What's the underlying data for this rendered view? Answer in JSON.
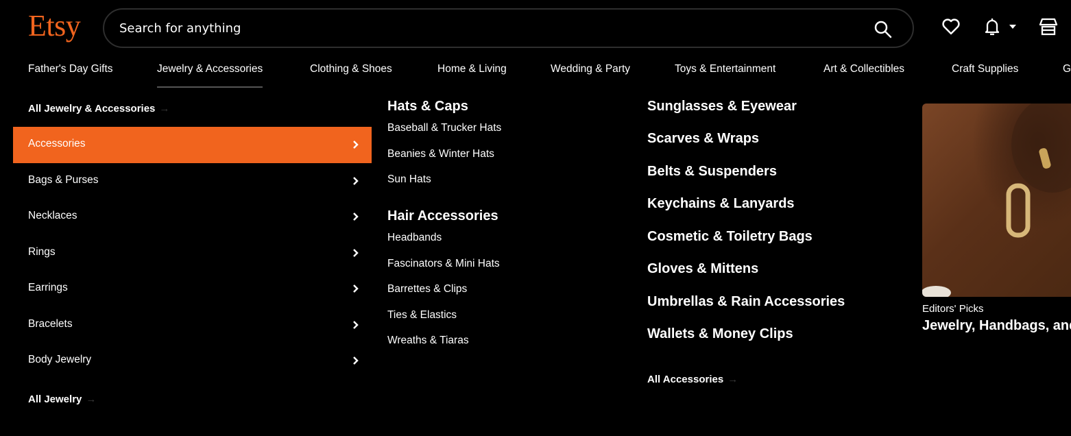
{
  "header": {
    "logo": "Etsy",
    "search_placeholder": "Search for anything",
    "search_value": "",
    "icons": [
      "search-icon",
      "heart-icon",
      "bell-icon",
      "caret-down-icon",
      "shop-icon"
    ]
  },
  "nav": {
    "items": [
      {
        "label": "Father's Day Gifts"
      },
      {
        "label": "Jewelry & Accessories",
        "active": true
      },
      {
        "label": "Clothing & Shoes"
      },
      {
        "label": "Home & Living"
      },
      {
        "label": "Wedding & Party"
      },
      {
        "label": "Toys & Entertainment"
      },
      {
        "label": "Art & Collectibles"
      },
      {
        "label": "Craft Supplies"
      },
      {
        "label": "G"
      }
    ]
  },
  "menu": {
    "all_top": "All Jewelry & Accessories",
    "categories": [
      {
        "label": "Accessories",
        "active": true
      },
      {
        "label": "Bags & Purses"
      },
      {
        "label": "Necklaces"
      },
      {
        "label": "Rings"
      },
      {
        "label": "Earrings"
      },
      {
        "label": "Bracelets"
      },
      {
        "label": "Body Jewelry"
      }
    ],
    "all_bottom": "All Jewelry",
    "accent_color": "#f1641e"
  },
  "sub_columns": {
    "hats": {
      "heading": "Hats & Caps",
      "items": [
        "Baseball & Trucker Hats",
        "Beanies & Winter Hats",
        "Sun Hats"
      ]
    },
    "hair": {
      "heading": "Hair Accessories",
      "items": [
        "Headbands",
        "Fascinators & Mini Hats",
        "Barrettes & Clips",
        "Ties & Elastics",
        "Wreaths & Tiaras"
      ]
    },
    "right": {
      "items": [
        "Sunglasses & Eyewear",
        "Scarves & Wraps",
        "Belts & Suspenders",
        "Keychains & Lanyards",
        "Cosmetic & Toiletry Bags",
        "Gloves & Mittens",
        "Umbrellas & Rain Accessories",
        "Wallets & Money Clips"
      ],
      "all_link": "All Accessories"
    }
  },
  "promo": {
    "kicker": "Editors' Picks",
    "title": "Jewelry, Handbags, and"
  }
}
